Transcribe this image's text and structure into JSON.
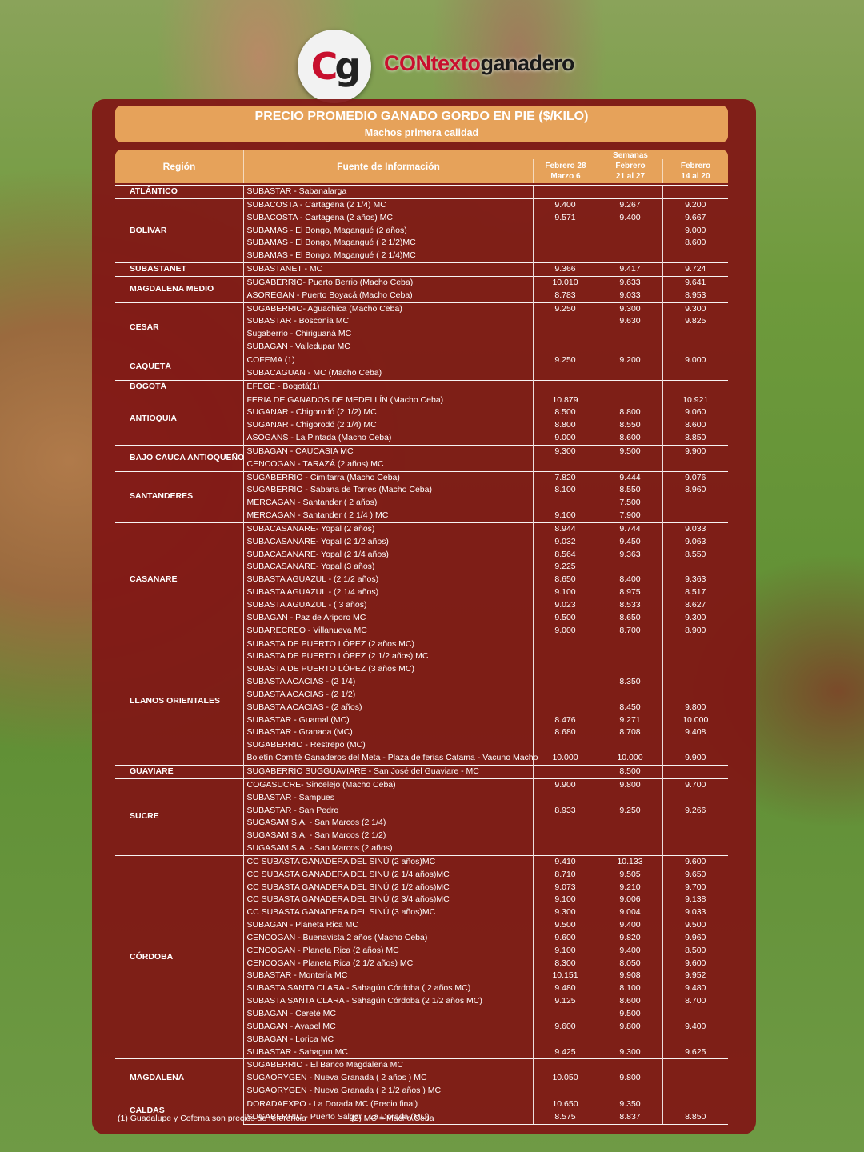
{
  "brand": {
    "prefix": "CONtexto",
    "suffix": "ganadero",
    "logo_c": "C",
    "logo_g": "g"
  },
  "title": "PRECIO PROMEDIO GANADO GORDO EN PIE ($/KILO)",
  "subtitle": "Machos primera calidad",
  "columns": {
    "region": "Región",
    "fuente": "Fuente de Información",
    "semanas": "Semanas",
    "w1_line1": "Febrero 28",
    "w1_line2": "Marzo 6",
    "w2_line1": "Febrero",
    "w2_line2": "21 al 27",
    "w3_line1": "Febrero",
    "w3_line2": "14 al 20"
  },
  "groups": [
    {
      "region": "ATLÁNTICO",
      "rows": [
        [
          "SUBASTAR - Sabanalarga",
          "",
          "",
          ""
        ]
      ]
    },
    {
      "region": "BOLÍVAR",
      "rows": [
        [
          "SUBACOSTA - Cartagena (2 1/4) MC",
          "9.400",
          "9.267",
          "9.200"
        ],
        [
          "SUBACOSTA - Cartagena (2 años) MC",
          "9.571",
          "9.400",
          "9.667"
        ],
        [
          "SUBAMAS - El Bongo, Magangué (2 años)",
          "",
          "",
          "9.000"
        ],
        [
          "SUBAMAS - El Bongo, Magangué ( 2 1/2)MC",
          "",
          "",
          "8.600"
        ],
        [
          "SUBAMAS - El Bongo, Magangué ( 2 1/4)MC",
          "",
          "",
          ""
        ]
      ]
    },
    {
      "region": "SUBASTANET",
      "rows": [
        [
          "SUBASTANET - MC",
          "9.366",
          "9.417",
          "9.724"
        ]
      ]
    },
    {
      "region": "MAGDALENA MEDIO",
      "rows": [
        [
          "SUGABERRIO- Puerto Berrio (Macho Ceba)",
          "10.010",
          "9.633",
          "9.641"
        ],
        [
          "ASOREGAN - Puerto Boyacá (Macho Ceba)",
          "8.783",
          "9.033",
          "8.953"
        ]
      ]
    },
    {
      "region": "CESAR",
      "rows": [
        [
          "SUGABERRIO- Aguachica  (Macho Ceba)",
          "9.250",
          "9.300",
          "9.300"
        ],
        [
          "SUBASTAR - Bosconia MC",
          "",
          "9.630",
          "9.825"
        ],
        [
          "Sugaberrio - Chiriguaná MC",
          "",
          "",
          ""
        ],
        [
          "SUBAGAN - Valledupar MC",
          "",
          "",
          ""
        ]
      ]
    },
    {
      "region": "CAQUETÁ",
      "rows": [
        [
          "COFEMA (1)",
          "9.250",
          "9.200",
          "9.000"
        ],
        [
          "SUBACAGUAN - MC (Macho Ceba)",
          "",
          "",
          ""
        ]
      ]
    },
    {
      "region": "BOGOTÁ",
      "rows": [
        [
          "EFEGE - Bogotá(1)",
          "",
          "",
          ""
        ]
      ]
    },
    {
      "region": "ANTIOQUIA",
      "rows": [
        [
          "FERIA DE GANADOS DE MEDELLÍN (Macho Ceba)",
          "10.879",
          "",
          "10.921"
        ],
        [
          "SUGANAR - Chigorodó (2 1/2) MC",
          "8.500",
          "8.800",
          "9.060"
        ],
        [
          "SUGANAR - Chigorodó (2 1/4) MC",
          "8.800",
          "8.550",
          "8.600"
        ],
        [
          "ASOGANS - La Pintada (Macho Ceba)",
          "9.000",
          "8.600",
          "8.850"
        ]
      ]
    },
    {
      "region": "BAJO CAUCA ANTIOQUEÑO",
      "rows": [
        [
          "SUBAGAN - CAUCASIA MC",
          "9.300",
          "9.500",
          "9.900"
        ],
        [
          "CENCOGAN - TARAZÁ (2 años) MC",
          "",
          "",
          ""
        ]
      ]
    },
    {
      "region": "SANTANDERES",
      "rows": [
        [
          "SUGABERRIO - Cimitarra (Macho Ceba)",
          "7.820",
          "9.444",
          "9.076"
        ],
        [
          "SUGABERRIO - Sabana de Torres (Macho Ceba)",
          "8.100",
          "8.550",
          "8.960"
        ],
        [
          "MERCAGAN - Santander ( 2 años)",
          "",
          "7.500",
          ""
        ],
        [
          "MERCAGAN - Santander ( 2 1/4 ) MC",
          "9.100",
          "7.900",
          ""
        ]
      ]
    },
    {
      "region": "CASANARE",
      "rows": [
        [
          "SUBACASANARE- Yopal (2 años)",
          "8.944",
          "9.744",
          "9.033"
        ],
        [
          "SUBACASANARE- Yopal (2 1/2 años)",
          "9.032",
          "9.450",
          "9.063"
        ],
        [
          "SUBACASANARE- Yopal (2 1/4 años)",
          "8.564",
          "9.363",
          "8.550"
        ],
        [
          "SUBACASANARE- Yopal (3 años)",
          "9.225",
          "",
          ""
        ],
        [
          "SUBASTA AGUAZUL - (2 1/2 años)",
          "8.650",
          "8.400",
          "9.363"
        ],
        [
          "SUBASTA AGUAZUL - (2 1/4 años)",
          "9.100",
          "8.975",
          "8.517"
        ],
        [
          "SUBASTA AGUAZUL - ( 3 años)",
          "9.023",
          "8.533",
          "8.627"
        ],
        [
          "SUBAGAN - Paz de Ariporo MC",
          "9.500",
          "8.650",
          "9.300"
        ],
        [
          "SUBARECREO - Villanueva MC",
          "9.000",
          "8.700",
          "8.900"
        ]
      ]
    },
    {
      "region": "LLANOS ORIENTALES",
      "rows": [
        [
          "SUBASTA DE PUERTO LÓPEZ (2 años MC)",
          "",
          "",
          ""
        ],
        [
          "SUBASTA DE PUERTO LÓPEZ (2 1/2 años) MC",
          "",
          "",
          ""
        ],
        [
          "SUBASTA DE PUERTO LÓPEZ (3 años MC)",
          "",
          "",
          ""
        ],
        [
          "SUBASTA ACACIAS -  (2 1/4)",
          "",
          "8.350",
          ""
        ],
        [
          "SUBASTA ACACIAS - (2 1/2)",
          "",
          "",
          ""
        ],
        [
          "SUBASTA ACACIAS - (2 años)",
          "",
          "8.450",
          "9.800"
        ],
        [
          "SUBASTAR - Guamal (MC)",
          "8.476",
          "9.271",
          "10.000"
        ],
        [
          "SUBASTAR - Granada (MC)",
          "8.680",
          "8.708",
          "9.408"
        ],
        [
          "SUGABERRIO - Restrepo (MC)",
          "",
          "",
          ""
        ],
        [
          "Boletín Comité Ganaderos del Meta - Plaza de ferias Catama - Vacuno Macho",
          "10.000",
          "10.000",
          "9.900"
        ]
      ]
    },
    {
      "region": "GUAVIARE",
      "rows": [
        [
          "SUGABERRIO SUGGUAVIARE - San José del Guaviare - MC",
          "",
          "8.500",
          ""
        ]
      ]
    },
    {
      "region": "SUCRE",
      "rows": [
        [
          "COGASUCRE- Sincelejo (Macho Ceba)",
          "9.900",
          "9.800",
          "9.700"
        ],
        [
          "SUBASTAR - Sampues",
          "",
          "",
          ""
        ],
        [
          "SUBASTAR - San Pedro",
          "8.933",
          "9.250",
          "9.266"
        ],
        [
          "SUGASAM S.A. - San Marcos (2 1/4)",
          "",
          "",
          ""
        ],
        [
          "SUGASAM S.A. - San Marcos (2 1/2)",
          "",
          "",
          ""
        ],
        [
          "SUGASAM S.A. - San Marcos (2 años)",
          "",
          "",
          ""
        ]
      ]
    },
    {
      "region": "CÓRDOBA",
      "rows": [
        [
          "CC SUBASTA GANADERA DEL SINÚ (2 años)MC",
          "9.410",
          "10.133",
          "9.600"
        ],
        [
          "CC SUBASTA GANADERA DEL SINÚ (2 1/4 años)MC",
          "8.710",
          "9.505",
          "9.650"
        ],
        [
          "CC SUBASTA GANADERA DEL SINÚ (2 1/2 años)MC",
          "9.073",
          "9.210",
          "9.700"
        ],
        [
          "CC SUBASTA GANADERA DEL SINÚ (2 3/4 años)MC",
          "9.100",
          "9.006",
          "9.138"
        ],
        [
          "CC SUBASTA GANADERA DEL SINÚ (3 años)MC",
          "9.300",
          "9.004",
          "9.033"
        ],
        [
          "SUBAGAN - Planeta Rica MC",
          "9.500",
          "9.400",
          "9.500"
        ],
        [
          "CENCOGAN - Buenavista 2 años (Macho Ceba)",
          "9.600",
          "9.820",
          "9.960"
        ],
        [
          "CENCOGAN - Planeta Rica (2 años) MC",
          "9.100",
          "9.400",
          "8.500"
        ],
        [
          "CENCOGAN - Planeta Rica (2 1/2 años) MC",
          "8.300",
          "8.050",
          "9.600"
        ],
        [
          "SUBASTAR - Montería MC",
          "10.151",
          "9.908",
          "9.952"
        ],
        [
          "SUBASTA SANTA CLARA - Sahagún Córdoba ( 2 años MC)",
          "9.480",
          "8.100",
          "9.480"
        ],
        [
          "SUBASTA SANTA CLARA - Sahagún Córdoba (2 1/2 años MC)",
          "9.125",
          "8.600",
          "8.700"
        ],
        [
          "SUBAGAN - Cereté MC",
          "",
          "9.500",
          ""
        ],
        [
          "SUBAGAN - Ayapel MC",
          "9.600",
          "9.800",
          "9.400"
        ],
        [
          "SUBAGAN - Lorica MC",
          "",
          "",
          ""
        ],
        [
          "SUBASTAR - Sahagun MC",
          "9.425",
          "9.300",
          "9.625"
        ]
      ]
    },
    {
      "region": "MAGDALENA",
      "rows": [
        [
          "SUGABERRIO - El Banco Magdalena MC",
          "",
          "",
          ""
        ],
        [
          "SUGAORYGEN - Nueva Granada ( 2 años ) MC",
          "10.050",
          "9.800",
          ""
        ],
        [
          "SUGAORYGEN - Nueva Granada ( 2 1/2 años ) MC",
          "",
          "",
          ""
        ]
      ]
    },
    {
      "region": "CALDAS",
      "rows": [
        [
          "DORADAEXPO - La Dorada MC (Precio final)",
          "10.650",
          "9.350",
          ""
        ],
        [
          "SUGABERRIO - Puerto Salgar - La Dorada (MC)",
          "8.575",
          "8.837",
          "8.850"
        ]
      ]
    }
  ],
  "footnotes": {
    "note1": "(1) Guadalupe y Cofema son precios de referencia",
    "note2": "(2) MC = Macho Ceba"
  }
}
